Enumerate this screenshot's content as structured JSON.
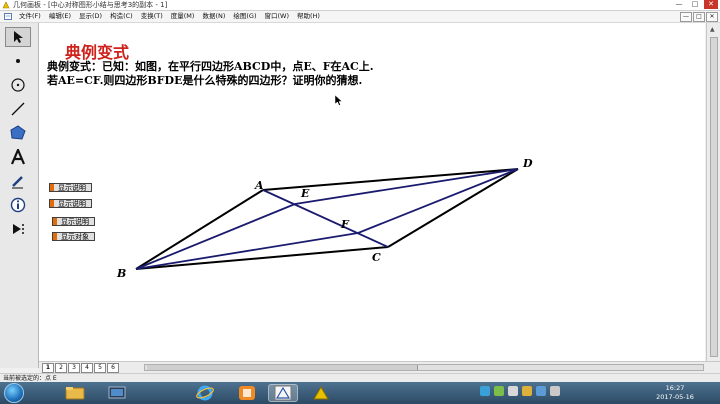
{
  "window": {
    "title": "几何画板 - [中心对称图形小结与思考3的副本 - 1]",
    "controls": [
      "—",
      "□",
      "✕"
    ]
  },
  "menubar": {
    "items": [
      "文件(F)",
      "编辑(E)",
      "显示(D)",
      "构造(C)",
      "变换(T)",
      "度量(M)",
      "数据(N)",
      "绘图(G)",
      "窗口(W)",
      "帮助(H)"
    ],
    "inner_controls": [
      "—",
      "□",
      "✕"
    ]
  },
  "toolbox": {
    "tools": [
      "arrow-select",
      "point",
      "compass-circle",
      "straightedge-line",
      "polygon",
      "text",
      "marker",
      "information",
      "custom-tools"
    ]
  },
  "content": {
    "heading": "典例变式",
    "problem_line1": "典例变式：已知：如图，在平行四边形ABCD中，点E、F在AC上.",
    "problem_line2": "若AE=CF.则四边形BFDE是什么特殊的四边形？证明你的猜想."
  },
  "buttons": [
    "显示说明",
    "显示说明",
    "显示说明",
    "显示对象"
  ],
  "diagram": {
    "points": [
      {
        "label": "A"
      },
      {
        "label": "B"
      },
      {
        "label": "C"
      },
      {
        "label": "D"
      },
      {
        "label": "E"
      },
      {
        "label": "F"
      }
    ],
    "colors": {
      "parallelogram": "#000000",
      "bfde": "#1a1a6e"
    }
  },
  "page_tabs": [
    "1",
    "2",
    "3",
    "4",
    "5",
    "6"
  ],
  "statusbar": {
    "text": "当前被选定的：点 E"
  },
  "taskbar": {
    "apps": [
      "ie-icon",
      "file-explorer-icon",
      "media-player-icon",
      "chrome-icon",
      "sketchpad-icon",
      "geometry-icon",
      "folder-icon",
      "word-icon"
    ],
    "clock_time": "16:27",
    "clock_date": "2017-05-16"
  }
}
